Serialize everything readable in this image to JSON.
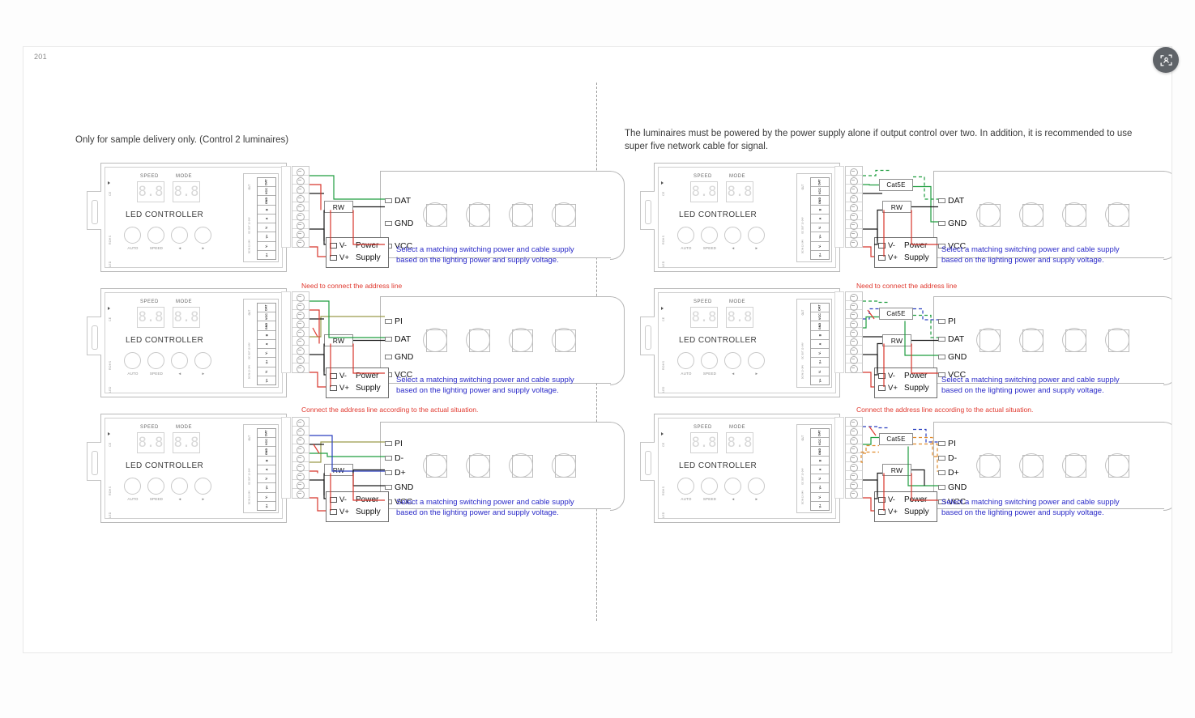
{
  "viewer": {
    "page_number": "201",
    "scan_button_icon": "scan-frame-icon"
  },
  "columns": {
    "left": {
      "heading": "Only for sample delivery only. (Control 2 luminaires)"
    },
    "right": {
      "heading": "The luminaires must be powered by the power supply alone if output control over two. In addition, it is recommended to use super five network cable for signal."
    }
  },
  "controller": {
    "title": "LED CONTROLLER",
    "speed_label": "SPEED",
    "mode_label": "MODE",
    "digit": "8.8",
    "knobs": [
      {
        "label": "AUTO"
      },
      {
        "label": "SPEED"
      },
      {
        "label": "◄"
      },
      {
        "label": "►"
      }
    ],
    "side_labels": [
      "CE",
      "ROHS",
      "LED"
    ],
    "terminal_out_label": "OUT",
    "terminal_pins": [
      "DAT",
      "VCC",
      "GND",
      "B",
      "A",
      "V-",
      "V+",
      "V-",
      "V+"
    ],
    "terminal_group_labels": [
      "DC OUT 12~24V",
      "DC IN 12~24V"
    ]
  },
  "boxes": {
    "rw": "RW",
    "cat5e": "Cat5E"
  },
  "power_supply": {
    "pin_negative": "V-",
    "pin_positive": "V+",
    "line1": "Power",
    "line2": "Supply"
  },
  "notes": {
    "blue_line1": "Select a matching switching power and cable supply",
    "blue_line2": "based on the lighting power and supply voltage.",
    "red_need_address": "Need to connect the address line",
    "red_actual_situation": "Connect the address line according to the actual situation."
  },
  "diagrams": [
    {
      "id": "left-1",
      "column": "left",
      "pins": [
        "DAT",
        "GND",
        "VCC"
      ],
      "has_cat5e": false,
      "red_note": null
    },
    {
      "id": "left-2",
      "column": "left",
      "pins": [
        "PI",
        "DAT",
        "GND",
        "VCC"
      ],
      "has_cat5e": false,
      "red_note": "Need to connect the address line"
    },
    {
      "id": "left-3",
      "column": "left",
      "pins": [
        "PI",
        "D-",
        "D+",
        "GND",
        "VCC"
      ],
      "has_cat5e": false,
      "red_note": "Connect the address line according to the actual situation."
    },
    {
      "id": "right-1",
      "column": "right",
      "pins": [
        "DAT",
        "GND",
        "VCC"
      ],
      "has_cat5e": true,
      "red_note": null
    },
    {
      "id": "right-2",
      "column": "right",
      "pins": [
        "PI",
        "DAT",
        "GND",
        "VCC"
      ],
      "has_cat5e": true,
      "red_note": "Need to connect the address line"
    },
    {
      "id": "right-3",
      "column": "right",
      "pins": [
        "PI",
        "D-",
        "D+",
        "GND",
        "VCC"
      ],
      "has_cat5e": true,
      "red_note": "Connect the address line according to the actual situation."
    }
  ],
  "colors": {
    "wire_green": "#1f9d3f",
    "wire_black": "#1a1a1a",
    "wire_red": "#d8362c",
    "wire_blue": "#2a3fbf",
    "wire_orange": "#e08a2a",
    "wire_olive": "#9a9a4a",
    "note_blue": "#2a2ac8",
    "note_red": "#e0392f",
    "accent_button": "#5f6368"
  }
}
